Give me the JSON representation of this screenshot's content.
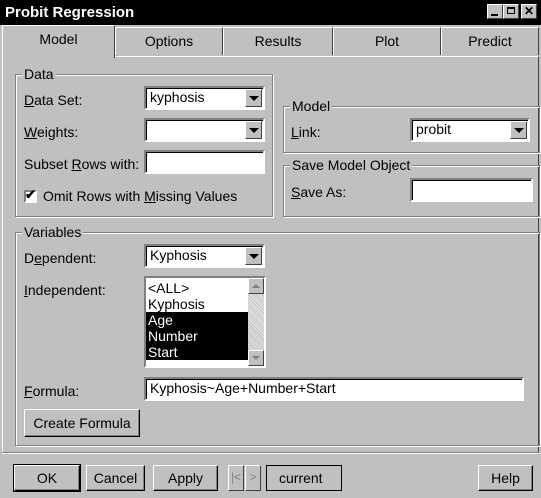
{
  "window": {
    "title": "Probit Regression"
  },
  "tabs": [
    {
      "label": "Model"
    },
    {
      "label": "Options"
    },
    {
      "label": "Results"
    },
    {
      "label": "Plot"
    },
    {
      "label": "Predict"
    }
  ],
  "data_group": {
    "title": "Data",
    "data_set_label": "Data Set:",
    "data_set_value": "kyphosis",
    "weights_label": "Weights:",
    "weights_value": "",
    "subset_label": "Subset Rows with:",
    "subset_value": "",
    "omit_missing_label": "Omit Rows with Missing Values",
    "omit_missing_checked": true
  },
  "model_group": {
    "title": "Model",
    "link_label": "Link:",
    "link_value": "probit"
  },
  "save_group": {
    "title": "Save Model Object",
    "save_as_label": "Save As:",
    "save_as_value": ""
  },
  "variables_group": {
    "title": "Variables",
    "dependent_label": "Dependent:",
    "dependent_value": "Kyphosis",
    "independent_label": "Independent:",
    "independent_items": [
      {
        "label": "<ALL>",
        "selected": false
      },
      {
        "label": "Kyphosis",
        "selected": false
      },
      {
        "label": "Age",
        "selected": true
      },
      {
        "label": "Number",
        "selected": true
      },
      {
        "label": "Start",
        "selected": true
      }
    ],
    "formula_label": "Formula:",
    "formula_value": "Kyphosis~Age+Number+Start",
    "create_formula_label": "Create Formula"
  },
  "footer": {
    "ok_label": "OK",
    "cancel_label": "Cancel",
    "apply_label": "Apply",
    "prev_label": "|<",
    "next_label": ">",
    "current_label": "current",
    "help_label": "Help"
  },
  "colors": {
    "face": "#c0c0c0",
    "titlebar": "#000000",
    "selection": "#000000"
  }
}
